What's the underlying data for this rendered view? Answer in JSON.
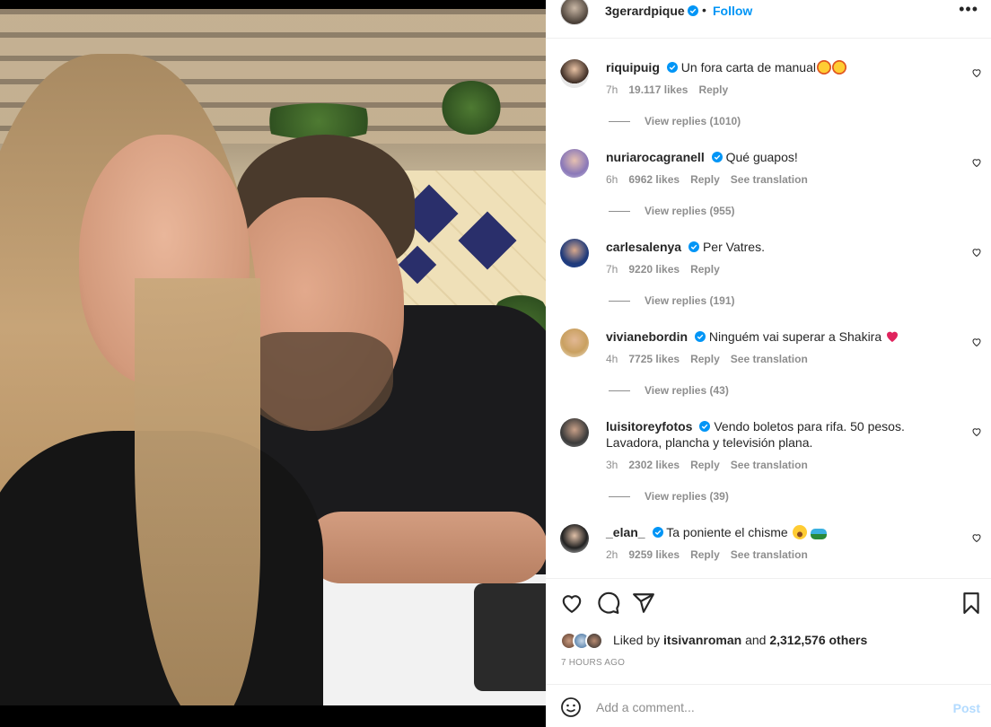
{
  "post": {
    "author": "3gerardpique",
    "dot": "•",
    "follow_label": "Follow",
    "more_label": "•••"
  },
  "comments": [
    {
      "username": "riquipuig",
      "verified": true,
      "text": "Un fora carta de manual",
      "emoji": [
        "star-struck-emoji",
        "star-struck-emoji"
      ],
      "time": "7h",
      "likes": "19.117 likes",
      "reply_label": "Reply",
      "translation_label": "",
      "replies_label": "View replies (1010)"
    },
    {
      "username": "nuriarocagranell",
      "verified": true,
      "text": "Qué guapos!",
      "emoji": [],
      "time": "6h",
      "likes": "6962 likes",
      "reply_label": "Reply",
      "translation_label": "See translation",
      "replies_label": "View replies (955)"
    },
    {
      "username": "carlesalenya",
      "verified": true,
      "text": "Per Vatres.",
      "emoji": [],
      "time": "7h",
      "likes": "9220 likes",
      "reply_label": "Reply",
      "translation_label": "",
      "replies_label": "View replies (191)"
    },
    {
      "username": "vivianebordin",
      "verified": true,
      "text": "Ninguém vai superar a Shakira",
      "emoji": [
        "red-heart-emoji"
      ],
      "time": "4h",
      "likes": "7725 likes",
      "reply_label": "Reply",
      "translation_label": "See translation",
      "replies_label": "View replies (43)"
    },
    {
      "username": "luisitoreyfotos",
      "verified": true,
      "text": "Vendo boletos para rifa. 50 pesos. Lavadora, plancha y televisión plana.",
      "emoji": [],
      "time": "3h",
      "likes": "2302 likes",
      "reply_label": "Reply",
      "translation_label": "See translation",
      "replies_label": "View replies (39)"
    },
    {
      "username": "_elan_",
      "verified": true,
      "text": "Ta poniente el chisme",
      "emoji": [
        "hushed-face-emoji",
        "car-emoji"
      ],
      "time": "2h",
      "likes": "9259 likes",
      "reply_label": "Reply",
      "translation_label": "See translation",
      "replies_label": ""
    }
  ],
  "actions": {
    "liked_by_prefix": "Liked by",
    "liked_by_user": "itsivanroman",
    "liked_by_and": "and",
    "liked_by_others": "2,312,576 others",
    "time_ago": "7 HOURS AGO"
  },
  "comment_box": {
    "placeholder": "Add a comment...",
    "post_label": "Post"
  },
  "colors": {
    "accent": "#0095f6",
    "verified": "#0095f6",
    "muted": "#8e8e8e",
    "post_disabled": "#b3dbff"
  }
}
